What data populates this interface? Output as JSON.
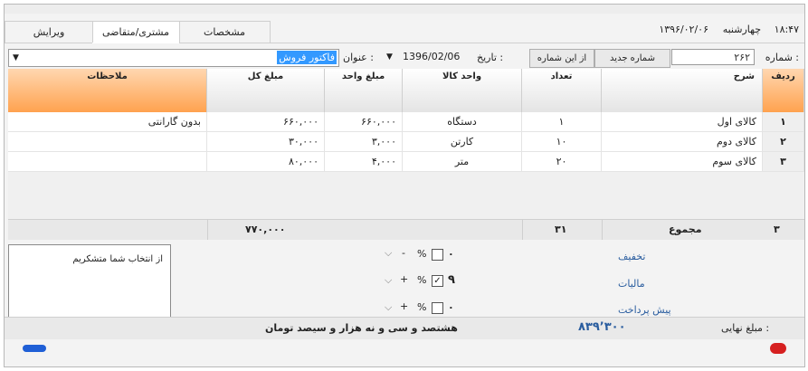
{
  "header": {
    "time": "۱۸:۴۷",
    "day": "چهارشنبه",
    "date": "۱۳۹۶/۰۲/۰۶"
  },
  "tabs": [
    {
      "label": "مشخصات"
    },
    {
      "label": "مشتری/متقاضی"
    },
    {
      "label": "ویرایش"
    }
  ],
  "form": {
    "number_label": "شماره :",
    "number_value": "۲۶۲",
    "new_number_button": "شماره جدید",
    "from_number_button": "از این شماره",
    "date_label": "تاریخ :",
    "date_value": "1396/02/06",
    "title_label": "عنوان :",
    "title_value": "فاکتور فروش"
  },
  "grid": {
    "columns": [
      {
        "label": "ردیف"
      },
      {
        "label": "شرح"
      },
      {
        "label": "تعداد"
      },
      {
        "label": "واحد کالا"
      },
      {
        "label": "مبلغ واحد"
      },
      {
        "label": "مبلغ کل"
      },
      {
        "label": "ملاحظات"
      }
    ],
    "rows": [
      {
        "index": "۱",
        "desc": "کالای اول",
        "qty": "۱",
        "unit": "دستگاه",
        "unit_price": "۶۶۰,۰۰۰",
        "total": "۶۶۰,۰۰۰",
        "notes": "بدون گارانتی"
      },
      {
        "index": "۲",
        "desc": "کالای دوم",
        "qty": "۱۰",
        "unit": "کارتن",
        "unit_price": "۳,۰۰۰",
        "total": "۳۰,۰۰۰",
        "notes": ""
      },
      {
        "index": "۳",
        "desc": "کالای سوم",
        "qty": "۲۰",
        "unit": "متر",
        "unit_price": "۴,۰۰۰",
        "total": "۸۰,۰۰۰",
        "notes": ""
      }
    ],
    "totals": {
      "row_count": "۳",
      "label": "مجموع",
      "qty": "۳۱",
      "total": "۷۷۰,۰۰۰"
    }
  },
  "notes_text": "از انتخاب شما متشکریم",
  "adjustments": [
    {
      "label": "تخفیف",
      "sign": "-",
      "value": "۰",
      "checked": false
    },
    {
      "label": "مالیات",
      "sign": "+",
      "value": "۹",
      "checked": true
    },
    {
      "label": "پیش پرداخت",
      "sign": "+",
      "value": "۰",
      "checked": false
    }
  ],
  "percent_symbol": "%",
  "final": {
    "label": "مبلغ نهایی :",
    "amount": "۸۳۹٬۳۰۰",
    "words": "هشتصد و سی و نه هزار و سیصد تومان"
  },
  "colors": {
    "accent_orange": "#ffa24f",
    "link_blue": "#2a5d9f",
    "highlight": "#3399ff"
  }
}
